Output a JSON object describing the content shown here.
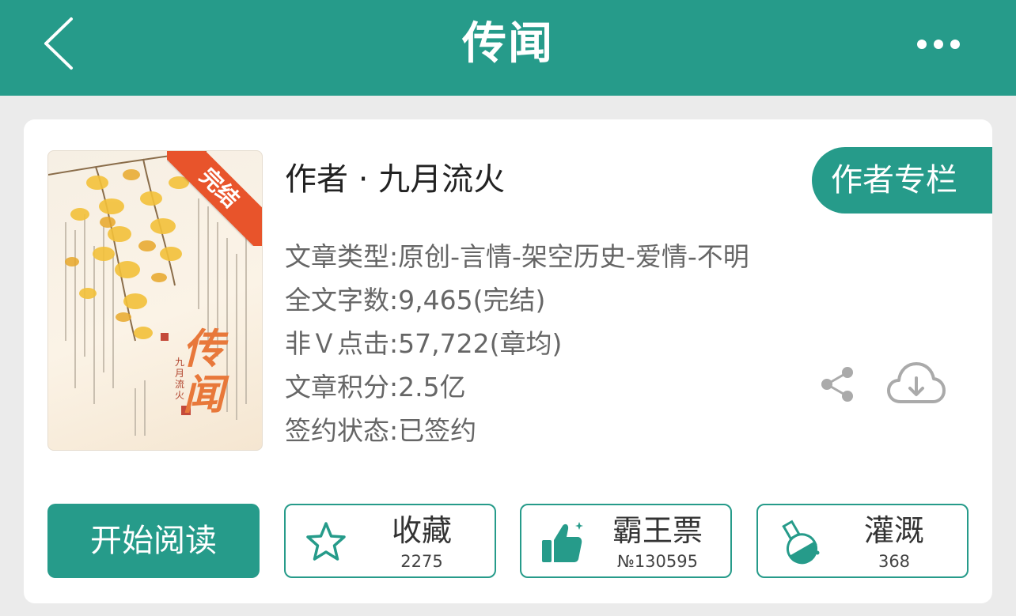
{
  "header": {
    "title": "传闻"
  },
  "book": {
    "badge": "完结",
    "cover_title": "传闻",
    "cover_author": "九月流火",
    "author": "作者 · 九月流火",
    "author_column_label": "作者专栏",
    "info": [
      "文章类型:原创-言情-架空历史-爱情-不明",
      "全文字数:9,465(完结)",
      "非Ｖ点击:57,722(章均)",
      "文章积分:2.5亿",
      "签约状态:已签约"
    ]
  },
  "actions": {
    "read_label": "开始阅读",
    "favorite": {
      "label": "收藏",
      "count": "2275"
    },
    "vote": {
      "label": "霸王票",
      "count": "№130595"
    },
    "nutrient": {
      "label": "灌溉",
      "count": "368"
    }
  },
  "icons": [
    "chevron-left-icon",
    "more-icon",
    "share-icon",
    "cloud-download-icon",
    "star-icon",
    "thumbs-up-icon",
    "flask-icon"
  ],
  "colors": {
    "accent": "#269b8a",
    "badge": "#e8542b",
    "background": "#ebebeb"
  }
}
